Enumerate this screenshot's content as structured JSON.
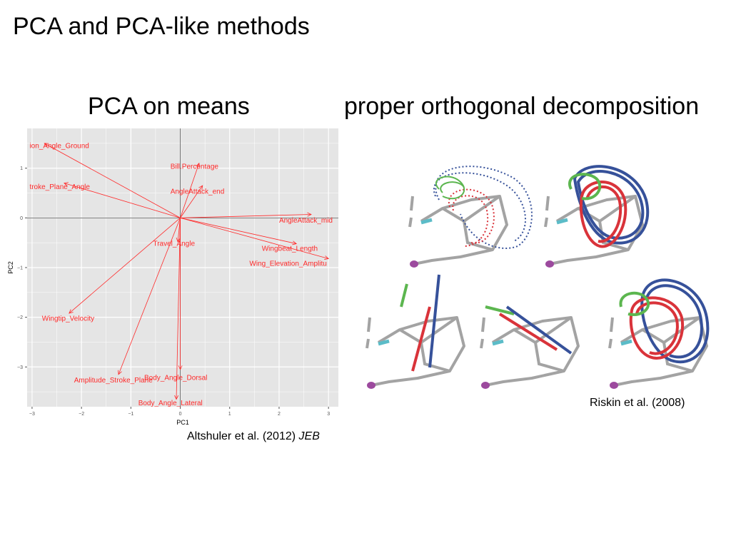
{
  "slide": {
    "title": "PCA and PCA-like methods",
    "left_heading": "PCA on means",
    "right_heading": "proper orthogonal decomposition",
    "left_citation": "Altshuler et al. (2012)",
    "left_citation_journal": "JEB",
    "right_citation": "Riskin et al. (2008)"
  },
  "chart_data": {
    "type": "biplot",
    "xlabel": "PC1",
    "ylabel": "PC2",
    "xlim": [
      -3.1,
      3.2
    ],
    "ylim": [
      -3.8,
      1.8
    ],
    "xticks": [
      -3,
      -2,
      -1,
      0,
      1,
      2,
      3
    ],
    "yticks": [
      -3,
      -2,
      -1,
      0,
      1
    ],
    "grid": true,
    "arrow_color": "#ff2a2a",
    "background": "#e5e5e5",
    "vectors": [
      {
        "name": "ion_Angle_Ground",
        "x": -2.75,
        "y": 1.5,
        "lx": -3.05,
        "ly": 1.45
      },
      {
        "name": "Bill.Percentage",
        "x": 0.38,
        "y": 1.1,
        "lx": -0.2,
        "ly": 1.03
      },
      {
        "name": "troke_Plane_Angle",
        "x": -2.35,
        "y": 0.7,
        "lx": -3.05,
        "ly": 0.62
      },
      {
        "name": "AngleAttack_end",
        "x": 0.45,
        "y": 0.65,
        "lx": -0.2,
        "ly": 0.53
      },
      {
        "name": "AngleAttack_mid",
        "x": 2.65,
        "y": 0.07,
        "lx": 2.0,
        "ly": -0.05
      },
      {
        "name": "Wingbeat_Length",
        "x": 2.35,
        "y": -0.52,
        "lx": 1.65,
        "ly": -0.62
      },
      {
        "name": "Wing_Elevation_Amplitu",
        "x": 3.0,
        "y": -0.82,
        "lx": 1.4,
        "ly": -0.92
      },
      {
        "name": "Travel_Angle",
        "x": -0.05,
        "y": -0.48,
        "lx": -0.55,
        "ly": -0.52
      },
      {
        "name": "Wingtip_Velocity",
        "x": -2.25,
        "y": -1.92,
        "lx": -2.8,
        "ly": -2.03
      },
      {
        "name": "Amplitude_Stroke_Plane",
        "x": -1.25,
        "y": -3.15,
        "lx": -2.15,
        "ly": -3.27
      },
      {
        "name": "Body_Angle_Dorsal",
        "x": 0.0,
        "y": -3.05,
        "lx": -0.73,
        "ly": -3.22
      },
      {
        "name": "Body_Angle_Lateral",
        "x": -0.08,
        "y": -3.65,
        "lx": -0.85,
        "ly": -3.73
      }
    ]
  },
  "figure_colors": {
    "skeleton": "#a3a3a3",
    "green": "#5cb64f",
    "red": "#d9333a",
    "blue": "#36519a",
    "cyan": "#5bbcc8",
    "purple": "#9c4a9e"
  }
}
